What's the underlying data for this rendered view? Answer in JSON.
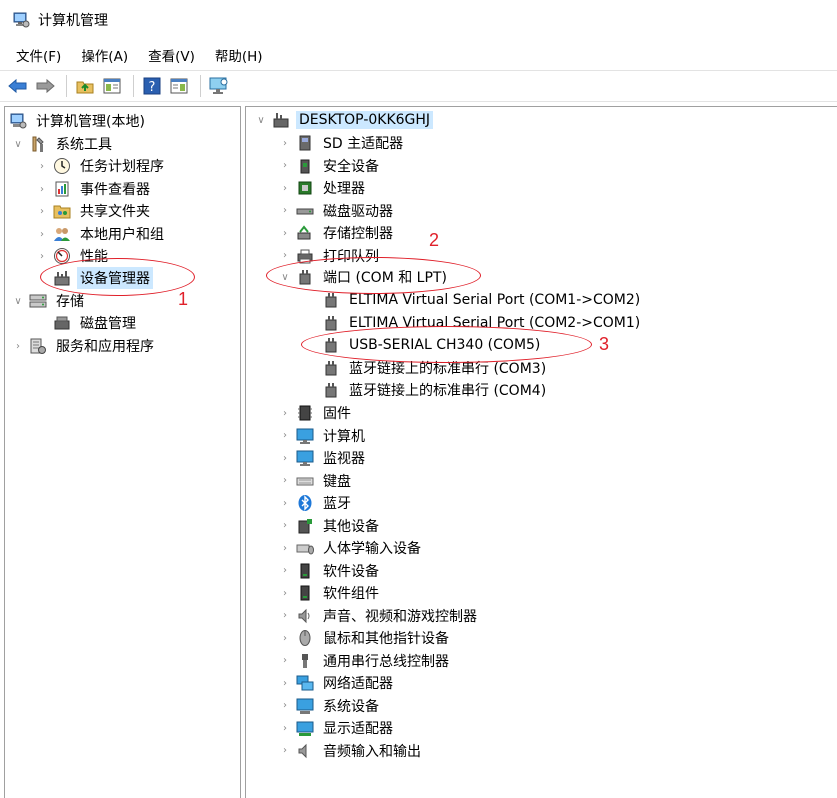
{
  "window": {
    "title": "计算机管理"
  },
  "menu": [
    "文件(F)",
    "操作(A)",
    "查看(V)",
    "帮助(H)"
  ],
  "left_tree": {
    "root": "计算机管理(本地)",
    "system_tools": "系统工具",
    "task_scheduler": "任务计划程序",
    "event_viewer": "事件查看器",
    "shared_folders": "共享文件夹",
    "local_users": "本地用户和组",
    "performance": "性能",
    "device_manager": "设备管理器",
    "storage": "存储",
    "disk_management": "磁盘管理",
    "services_apps": "服务和应用程序"
  },
  "right_tree": {
    "computer": "DESKTOP-0KK6GHJ",
    "categories_top": [
      "SD 主适配器",
      "安全设备",
      "处理器",
      "磁盘驱动器",
      "存储控制器",
      "打印队列"
    ],
    "ports": "端口 (COM 和 LPT)",
    "port_devices": [
      "ELTIMA Virtual Serial Port (COM1->COM2)",
      "ELTIMA Virtual Serial Port (COM2->COM1)",
      "USB-SERIAL CH340 (COM5)",
      "蓝牙链接上的标准串行 (COM3)",
      "蓝牙链接上的标准串行 (COM4)"
    ],
    "categories_bottom": [
      "固件",
      "计算机",
      "监视器",
      "键盘",
      "蓝牙",
      "其他设备",
      "人体学输入设备",
      "软件设备",
      "软件组件",
      "声音、视频和游戏控制器",
      "鼠标和其他指针设备",
      "通用串行总线控制器",
      "网络适配器",
      "系统设备",
      "显示适配器",
      "音频输入和输出"
    ]
  },
  "annotations": [
    "1",
    "2",
    "3"
  ]
}
